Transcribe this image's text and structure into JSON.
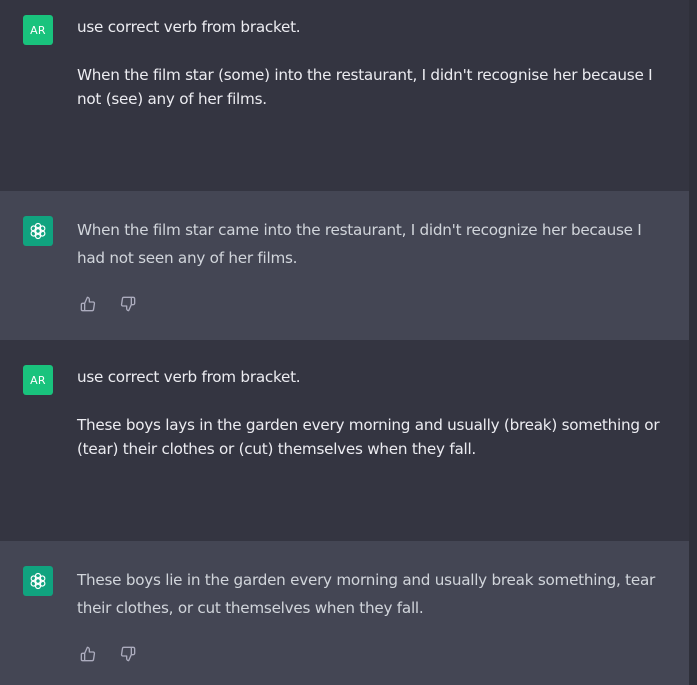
{
  "messages": [
    {
      "role": "user",
      "avatar": "AR",
      "paragraphs": [
        "use correct verb from bracket.",
        "When the film star (some) into the restaurant, I didn't recognise her because I not (see) any of her films."
      ]
    },
    {
      "role": "assistant",
      "avatar_icon": "openai-logo-icon",
      "paragraphs": [
        "When the film star came into the restaurant, I didn't recognize her because I had not seen any of her films."
      ],
      "actions": [
        "thumbs-up-icon",
        "thumbs-down-icon"
      ]
    },
    {
      "role": "user",
      "avatar": "AR",
      "paragraphs": [
        "use correct verb from bracket.",
        "These boys lays in the garden every morning and usually (break) something or (tear) their clothes or (cut) themselves when they fall."
      ]
    },
    {
      "role": "assistant",
      "avatar_icon": "openai-logo-icon",
      "paragraphs": [
        "These boys lie in the garden every morning and usually break something, tear their clothes, or cut themselves when they fall."
      ],
      "actions": [
        "thumbs-up-icon",
        "thumbs-down-icon"
      ]
    }
  ],
  "colors": {
    "background": "#343541",
    "assistant_background": "#444654",
    "user_avatar": "#19c37d",
    "bot_avatar": "#10a37f",
    "user_text": "#ececf1",
    "assistant_text": "#d1d5db",
    "icon": "#acacbe"
  }
}
